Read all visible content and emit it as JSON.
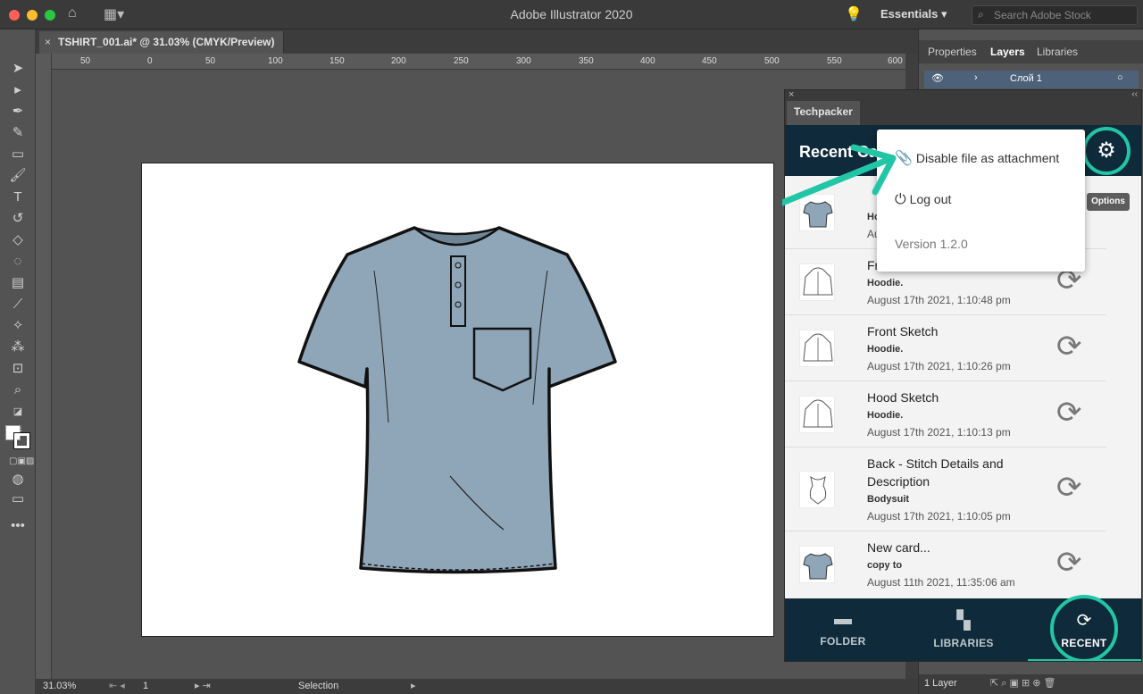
{
  "app": {
    "title": "Adobe Illustrator 2020",
    "workspace": "Essentials",
    "stock_placeholder": "Search Adobe Stock"
  },
  "document": {
    "tab_label": "TSHIRT_001.ai* @ 31.03% (CMYK/Preview)",
    "close_glyph": "×"
  },
  "ruler": {
    "h_ticks": [
      "50",
      "0",
      "50",
      "100",
      "150",
      "200",
      "250",
      "300",
      "350",
      "400",
      "450",
      "500",
      "550",
      "600"
    ]
  },
  "status": {
    "zoom": "31.03%",
    "artboard": "1",
    "tool": "Selection"
  },
  "right_panel": {
    "tabs": [
      "Properties",
      "Layers",
      "Libraries"
    ],
    "layer_name": "Слой 1",
    "layers_count": "1 Layer"
  },
  "techpacker": {
    "tab": "Techpacker",
    "header_title": "Recent Ca",
    "options_label": "Options",
    "menu": {
      "disable_attachment": "Disable file as attachment",
      "logout": "Log out",
      "version": "Version 1.2.0"
    },
    "cards": [
      {
        "title": "",
        "subtitle": "Ho",
        "date": "Au"
      },
      {
        "title": "Fr",
        "subtitle": "Hoodie.",
        "date": "August 17th 2021, 1:10:48 pm"
      },
      {
        "title": "Front Sketch",
        "subtitle": "Hoodie.",
        "date": "August 17th 2021, 1:10:26 pm"
      },
      {
        "title": "Hood Sketch",
        "subtitle": "Hoodie.",
        "date": "August 17th 2021, 1:10:13 pm"
      },
      {
        "title": "Back - Stitch Details and Description",
        "subtitle": "Bodysuit",
        "date": "August 17th 2021, 1:10:05 pm"
      },
      {
        "title": "New card...",
        "subtitle": "copy to",
        "date": "August 11th 2021, 11:35:06 am"
      }
    ],
    "footer": {
      "folder": "FOLDER",
      "libraries": "LIBRARIES",
      "recent": "RECENT"
    }
  },
  "colors": {
    "accent": "#22c6a6",
    "navy": "#0f2a3a",
    "shirt": "#8fa5b8"
  }
}
